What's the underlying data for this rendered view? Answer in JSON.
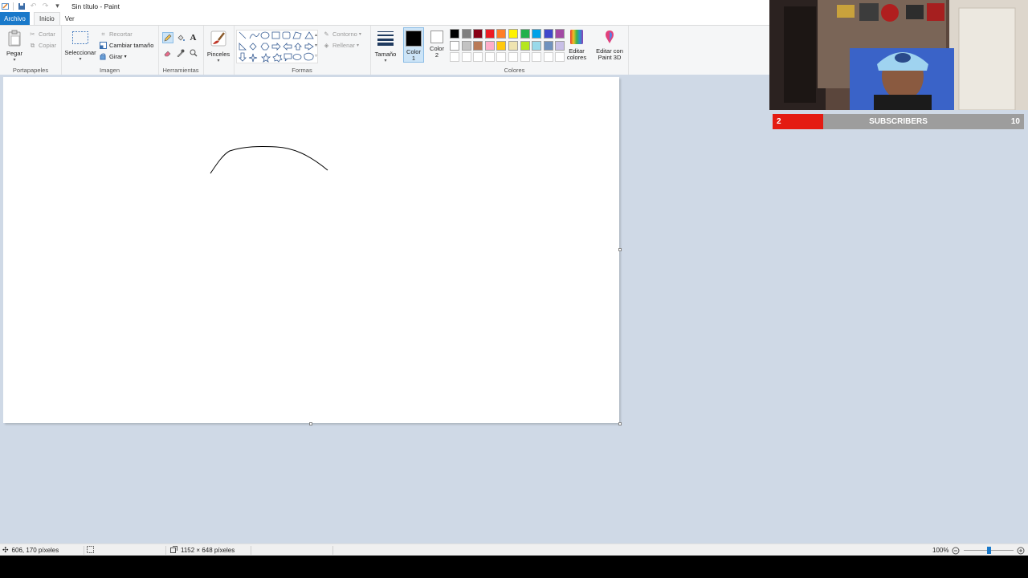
{
  "window": {
    "title": "Sin título - Paint"
  },
  "tabs": {
    "file": "Archivo",
    "home": "Inicio",
    "view": "Ver"
  },
  "ribbon": {
    "clipboard": {
      "label": "Portapapeles",
      "paste": "Pegar",
      "cut": "Cortar",
      "copy": "Copiar"
    },
    "image": {
      "label": "Imagen",
      "select": "Seleccionar",
      "crop": "Recortar",
      "resize": "Cambiar tamaño",
      "rotate": "Girar"
    },
    "tools": {
      "label": "Herramientas"
    },
    "brushes": {
      "label": "Pinceles"
    },
    "shapes": {
      "label": "Formas",
      "outline": "Contorno",
      "fill": "Rellenar"
    },
    "size": {
      "label": "Tamaño"
    },
    "colors": {
      "label": "Colores",
      "color1_label": "Color",
      "color1_num": "1",
      "color2_label": "Color",
      "color2_num": "2",
      "color1": "#000000",
      "color2": "#ffffff",
      "edit_colors_1": "Editar",
      "edit_colors_2": "colores",
      "edit_3d_1": "Editar con",
      "edit_3d_2": "Paint 3D",
      "palette_row1": [
        "#000000",
        "#7f7f7f",
        "#880015",
        "#ed1c24",
        "#ff7f27",
        "#fff200",
        "#22b14c",
        "#00a2e8",
        "#3f48cc",
        "#a349a4"
      ],
      "palette_row2": [
        "#ffffff",
        "#c3c3c3",
        "#b97a57",
        "#ffaec9",
        "#ffc90e",
        "#efe4b0",
        "#b5e61d",
        "#99d9ea",
        "#7092be",
        "#c8bfe7"
      ]
    }
  },
  "status": {
    "cursor": "606, 170 píxeles",
    "canvas_size": "1152 × 648 píxeles",
    "zoom": "100%",
    "zoom_fraction": 0.5
  },
  "stream": {
    "sub_current": "2",
    "sub_label": "SUBSCRIBERS",
    "sub_goal": "10",
    "sub_fraction": 0.2
  }
}
